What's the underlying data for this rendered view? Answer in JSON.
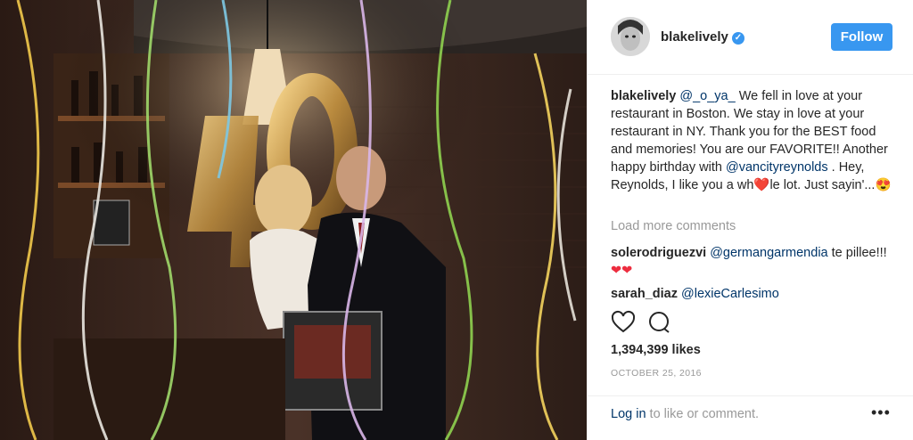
{
  "header": {
    "username": "blakelively",
    "verified_icon": "verified-badge-icon",
    "follow_label": "Follow"
  },
  "caption": {
    "username": "blakelively",
    "mention_1": "@_o_ya_",
    "text_1": " We fell in love at your restaurant in Boston. We stay in love at your restaurant in NY. Thank you for the BEST food and memories! You are our FAVORITE!! Another happy birthday with ",
    "mention_2": "@vancityreynolds",
    "text_2": " . Hey, Reynolds, I like you a wh",
    "heart": "❤️",
    "text_3": "le lot. Just sayin'...",
    "emoji": "😍"
  },
  "load_more": "Load more comments",
  "comments": [
    {
      "username": "solerodriguezvi",
      "mention": "@germangarmendia",
      "text": " te pillee!!!",
      "emoji": "❤❤"
    },
    {
      "username": "sarah_diaz",
      "mention": "@lexieCarlesimo",
      "text": ""
    }
  ],
  "likes": "1,394,399 likes",
  "date": "OCTOBER 25, 2016",
  "footer": {
    "login_link": "Log in",
    "login_text": " to like or comment.",
    "more_label": "•••"
  },
  "colors": {
    "accent": "#3897f0",
    "link": "#003569",
    "muted": "#999999",
    "heart": "#ed2d3f"
  }
}
